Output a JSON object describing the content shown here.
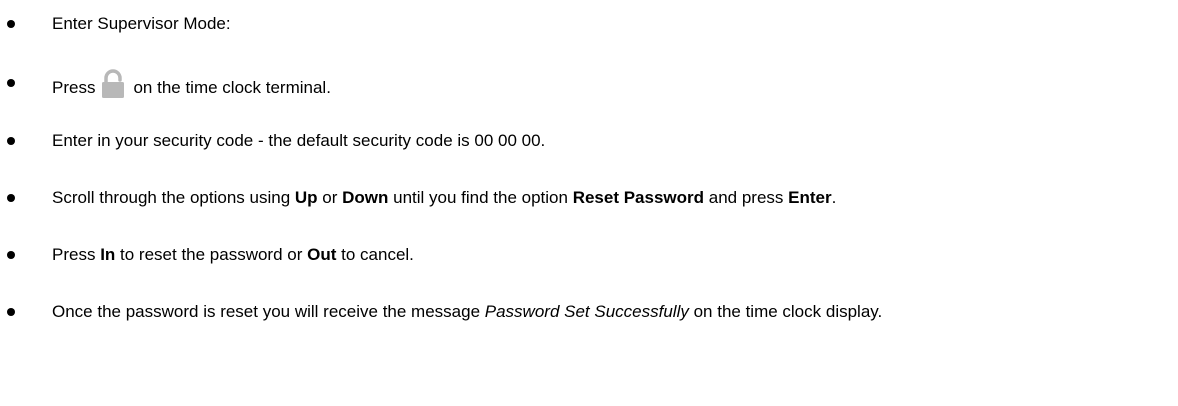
{
  "items": [
    {
      "text": "Enter Supervisor Mode:"
    },
    {
      "before": "Press",
      "icon": "lock-icon",
      "after": "on the time clock terminal."
    },
    {
      "text": "Enter in your security code - the default security code is 00 00 00."
    },
    {
      "p1": "Scroll through the options using ",
      "b1": "Up",
      "p2": " or ",
      "b2": "Down",
      "p3": " until you find the option ",
      "b3": "Reset Password",
      "p4": " and press ",
      "b4": "Enter",
      "p5": "."
    },
    {
      "p1": "Press ",
      "b1": "In",
      "p2": " to reset the password or ",
      "b2": "Out",
      "p3": " to cancel."
    },
    {
      "p1": "Once the password is reset you will receive the message ",
      "i1": "Password Set Successfully",
      "p2": " on the time clock display."
    }
  ],
  "colors": {
    "text": "#000000",
    "icon": "#b8b8b8"
  }
}
